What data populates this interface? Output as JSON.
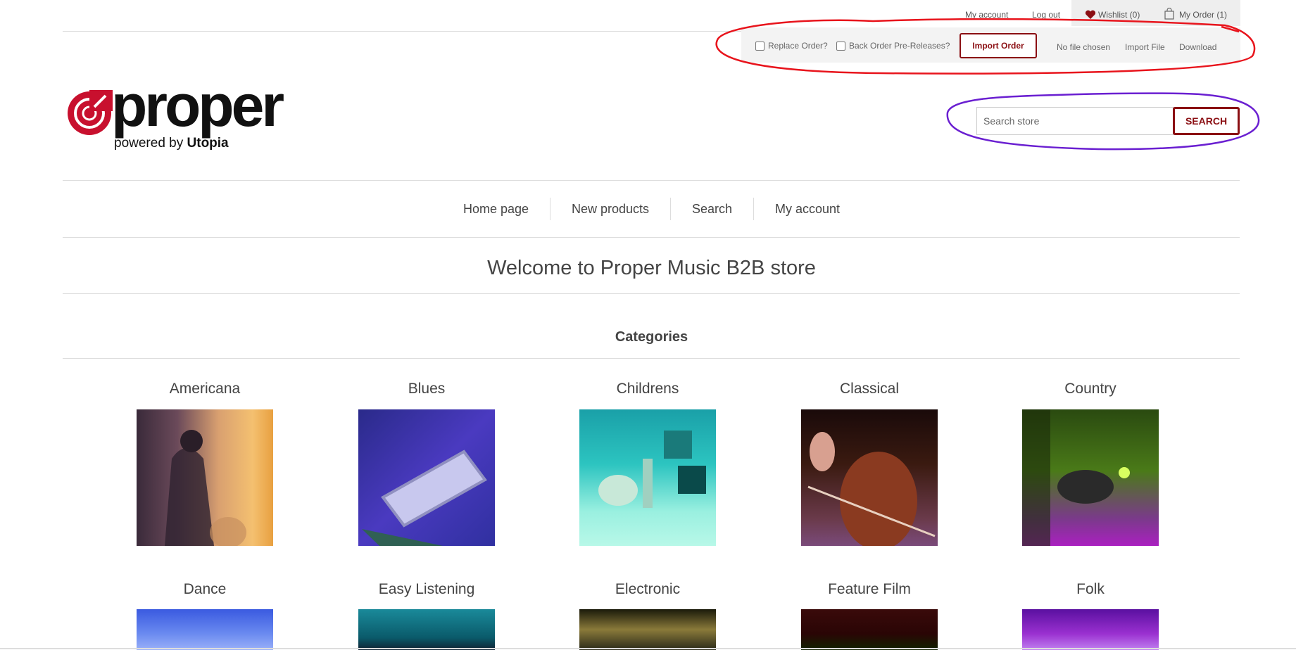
{
  "header": {
    "links": {
      "my_account": "My account",
      "log_out": "Log out",
      "wishlist": "Wishlist (0)",
      "my_order": "My Order (1)"
    },
    "import": {
      "replace_order": "Replace Order?",
      "back_order": "Back Order Pre-Releases?",
      "import_order_button": "Import Order",
      "no_file": "No file chosen",
      "import_file": "Import File",
      "download": "Download"
    },
    "logo": {
      "word": "proper",
      "powered_by": "powered by",
      "brand": "Utopia"
    },
    "search": {
      "placeholder": "Search store",
      "button": "SEARCH"
    }
  },
  "nav": [
    "Home page",
    "New products",
    "Search",
    "My account"
  ],
  "welcome": "Welcome to Proper Music B2B store",
  "categories_heading": "Categories",
  "categories_row1": [
    "Americana",
    "Blues",
    "Childrens",
    "Classical",
    "Country"
  ],
  "categories_row2": [
    "Dance",
    "Easy Listening",
    "Electronic",
    "Feature Film",
    "Folk"
  ],
  "colors": {
    "brand_red": "#8b0f13",
    "annotation_red": "#e8141c",
    "annotation_purple": "#6a1fd1"
  }
}
